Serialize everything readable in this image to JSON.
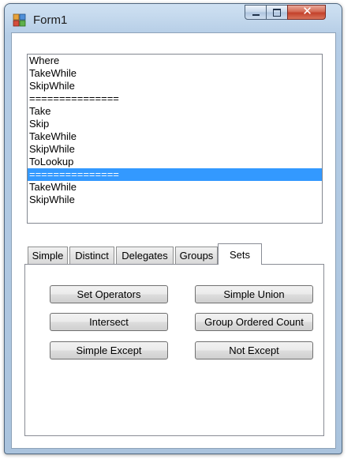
{
  "window": {
    "title": "Form1",
    "controls": {
      "minimize": "minimize",
      "maximize": "maximize",
      "close": "✕"
    }
  },
  "listbox": {
    "items": [
      {
        "text": "Where",
        "selected": false
      },
      {
        "text": "TakeWhile",
        "selected": false
      },
      {
        "text": "SkipWhile",
        "selected": false
      },
      {
        "text": "===============",
        "selected": false
      },
      {
        "text": "Take",
        "selected": false
      },
      {
        "text": "Skip",
        "selected": false
      },
      {
        "text": "TakeWhile",
        "selected": false
      },
      {
        "text": "SkipWhile",
        "selected": false
      },
      {
        "text": "ToLookup",
        "selected": false
      },
      {
        "text": "===============",
        "selected": true
      },
      {
        "text": "TakeWhile",
        "selected": false
      },
      {
        "text": "SkipWhile",
        "selected": false
      }
    ]
  },
  "tabs": [
    {
      "label": "Simple",
      "active": false
    },
    {
      "label": "Distinct",
      "active": false
    },
    {
      "label": "Delegates",
      "active": false
    },
    {
      "label": "Groups",
      "active": false
    },
    {
      "label": "Sets",
      "active": true
    }
  ],
  "buttons": [
    {
      "label": "Set Operators"
    },
    {
      "label": "Simple Union"
    },
    {
      "label": "Intersect"
    },
    {
      "label": "Group Ordered Count"
    },
    {
      "label": "Simple Except"
    },
    {
      "label": "Not Except"
    }
  ],
  "colors": {
    "selection": "#3399ff",
    "window_frame": "#b5cde6",
    "close_button": "#c3412b"
  }
}
